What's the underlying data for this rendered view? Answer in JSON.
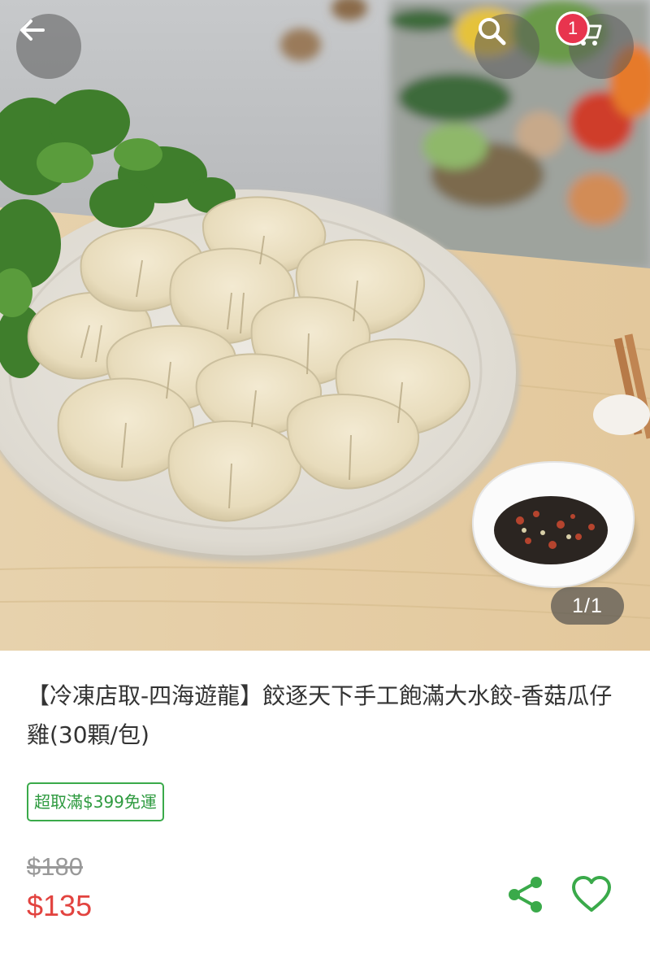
{
  "header": {
    "back_icon": "arrow-left-icon",
    "search_icon": "search-icon",
    "cart_icon": "cart-icon",
    "cart_count": "1"
  },
  "gallery": {
    "counter": "1/1"
  },
  "product": {
    "title": "【冷凍店取-四海遊龍】餃逐天下手工飽滿大水餃-香菇瓜仔雞(30顆/包)",
    "promo_tag": "超取滿$399免運",
    "original_price": "$180",
    "price": "$135"
  },
  "actions": {
    "share_icon": "share-icon",
    "favorite_icon": "heart-icon"
  },
  "colors": {
    "accent_green": "#3aaa4a",
    "price_red": "#e2433f",
    "badge_red": "#e8344e"
  }
}
